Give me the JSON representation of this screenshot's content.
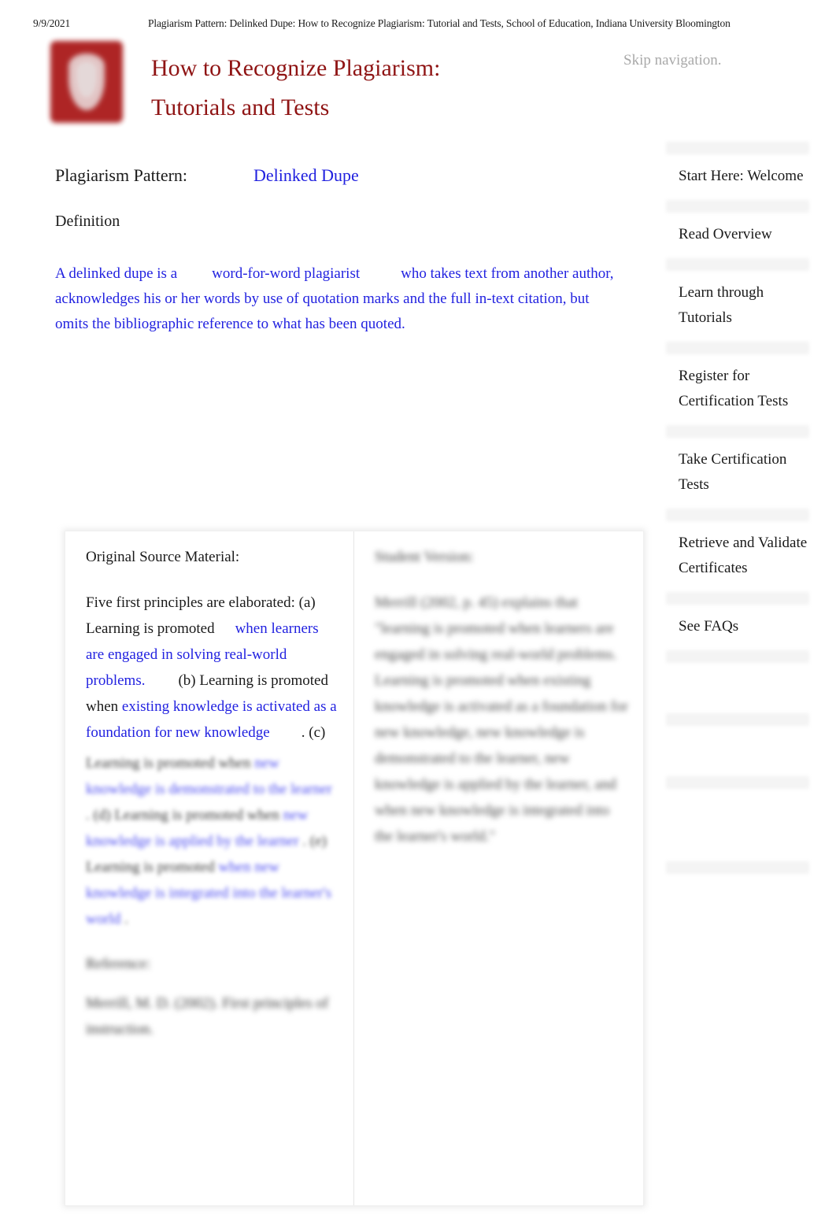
{
  "print_header": {
    "date": "9/9/2021",
    "title": "Plagiarism Pattern: Delinked Dupe: How to Recognize Plagiarism: Tutorial and Tests, School of Education, Indiana University Bloomington"
  },
  "masthead": {
    "logo_alt": "indiana-university-trident-logo",
    "site_title_line1": "How to Recognize Plagiarism:",
    "site_title_line2": "Tutorials and Tests",
    "skip_navigation": "Skip navigation.",
    "brand_red": "#8f1414"
  },
  "main": {
    "pattern_label": "Plagiarism Pattern:",
    "pattern_value": "Delinked Dupe",
    "definition_label": "Definition",
    "definition_text_part1": "A delinked dupe is a",
    "definition_text_part2": "word-for-word plagiarist",
    "definition_text_part3": "who takes text from another author, acknowledges his or her words by use of quotation marks and the full in-text citation, but omits the bibliographic reference to what has been quoted.",
    "link_blue": "#2222e0"
  },
  "compare": {
    "left": {
      "title": "Original Source Material:",
      "body_segments": [
        {
          "text": "Five first principles are elaborated: (a) Learning is promoted",
          "quoted": false
        },
        {
          "text": "when learners are engaged in solving real-world problems.",
          "quoted": true
        },
        {
          "text": "(b) Learning is promoted when",
          "quoted": false
        },
        {
          "text": "existing knowledge is activated as a foundation for new knowledge",
          "quoted": true
        },
        {
          "text": ". (c)",
          "quoted": false
        }
      ],
      "continuation_segments": [
        {
          "text": "Learning is promoted when",
          "quoted": false
        },
        {
          "text": "new knowledge is demonstrated to the learner",
          "quoted": true
        },
        {
          "text": ". (d) Learning is promoted when",
          "quoted": false
        },
        {
          "text": "new knowledge is applied by the learner",
          "quoted": true
        },
        {
          "text": ". (e) Learning is promoted",
          "quoted": false
        },
        {
          "text": "when new knowledge is integrated into the learner's world",
          "quoted": true
        },
        {
          "text": ".",
          "quoted": false
        }
      ],
      "reference_label": "Reference:",
      "reference_text": "Merrill, M. D. (2002). First principles of instruction."
    },
    "right": {
      "title": "Student Version:",
      "body_text": "Merrill (2002, p. 45) explains that \"learning is promoted when learners are engaged in solving real-world problems. Learning is promoted when existing knowledge is activated as a foundation for new knowledge, new knowledge is demonstrated to the learner, new knowledge is applied by the learner, and when new knowledge is integrated into the learner's world.\""
    }
  },
  "sidebar": {
    "items": [
      {
        "label": "Start Here: Welcome"
      },
      {
        "label": "Read Overview"
      },
      {
        "label": "Learn through Tutorials"
      },
      {
        "label": "Register for Certification Tests"
      },
      {
        "label": "Take Certification Tests"
      },
      {
        "label": "Retrieve and Validate Certificates"
      },
      {
        "label": "See FAQs"
      }
    ]
  }
}
